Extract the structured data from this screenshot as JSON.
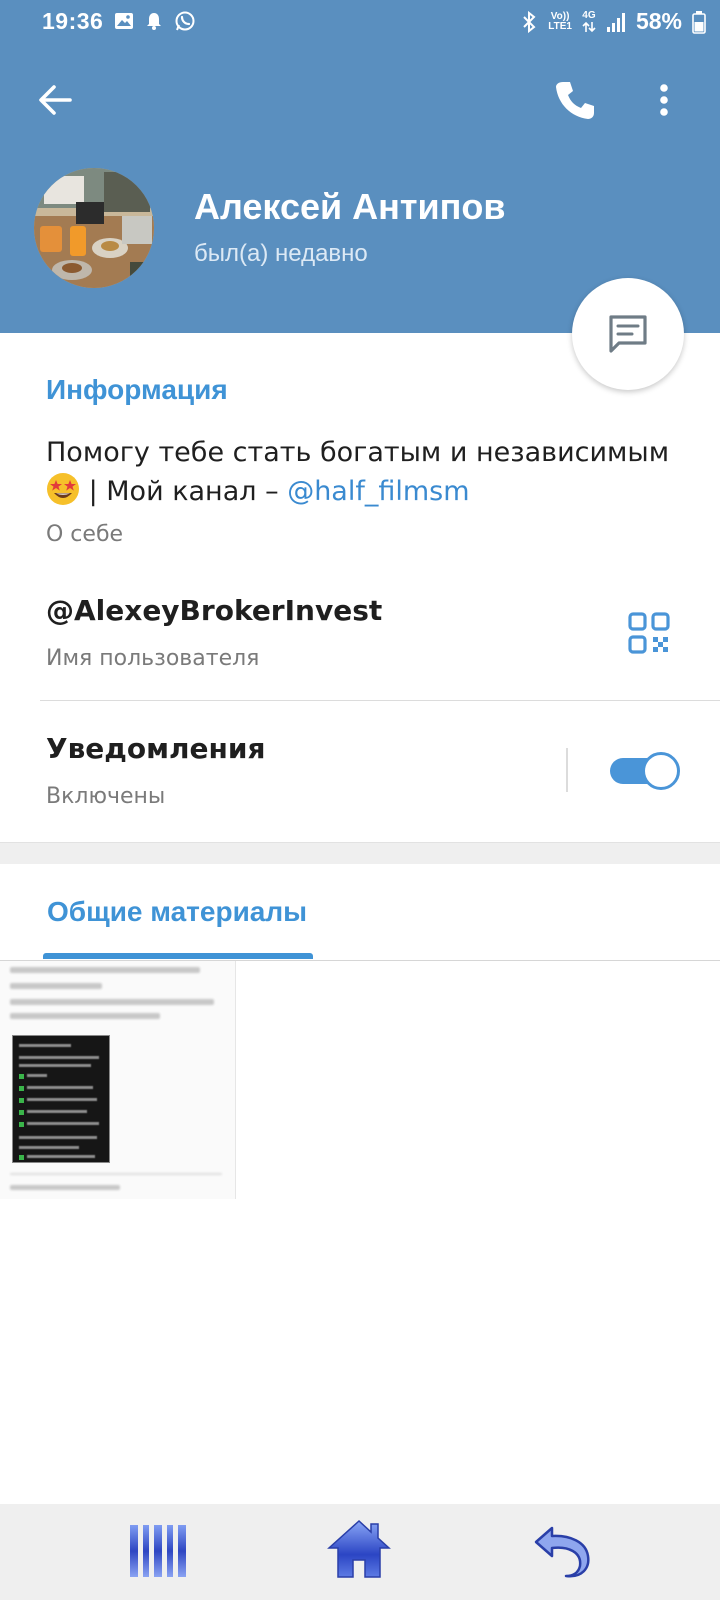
{
  "status_bar": {
    "time": "19:36",
    "battery_percent": "58%",
    "network_label": "4G",
    "volte_label": "Vo))",
    "lte_label": "LTE1",
    "left_icons": [
      "image-icon",
      "notification-bell-icon",
      "whatsapp-icon"
    ],
    "right_icons": [
      "bluetooth-icon",
      "volte-icon",
      "4g-icon",
      "signal-icon",
      "battery-icon"
    ]
  },
  "header": {
    "background_color": "#5a8fbf",
    "back_icon": "arrow-left-icon",
    "call_icon": "phone-icon",
    "more_icon": "more-vertical-icon"
  },
  "profile": {
    "name": "Алексей Антипов",
    "status": "был(а) недавно"
  },
  "info_section": {
    "title": "Информация",
    "bio_text": "Помогу тебе стать богатым и независимым",
    "bio_second_line": " | Мой канал – ",
    "bio_link": "@half_filmsm",
    "bio_label": "О себе",
    "username": "@AlexeyBrokerInvest",
    "username_label": "Имя пользователя",
    "notifications_title": "Уведомления",
    "notifications_state": "Включены",
    "notifications_enabled": true
  },
  "media_section": {
    "title": "Общие материалы"
  },
  "nav_bar": {
    "icons": [
      "recent-apps-icon",
      "home-icon",
      "back-icon"
    ]
  }
}
